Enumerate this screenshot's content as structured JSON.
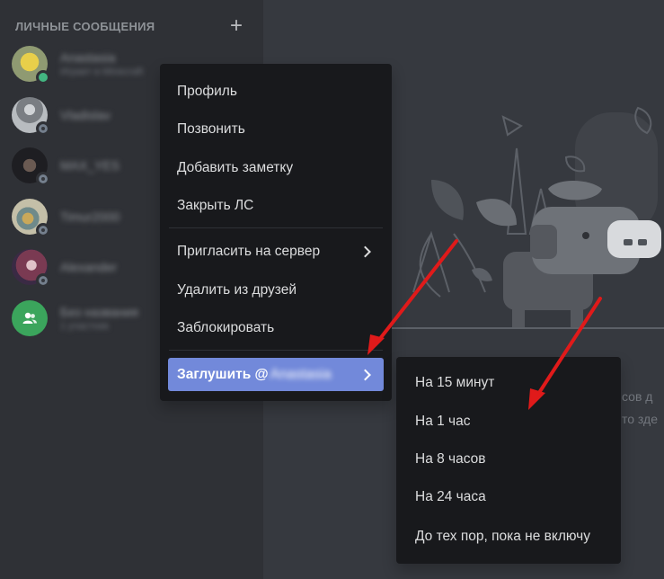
{
  "sidebar": {
    "title": "ЛИЧНЫЕ СООБЩЕНИЯ",
    "add_icon": "plus-icon",
    "dms": [
      {
        "name": "Anastasia",
        "sub": "Играет в Minecraft",
        "status": "online",
        "avatar_color": "#c9b04a"
      },
      {
        "name": "Vladislav",
        "sub": "",
        "status": "offline",
        "avatar_color": "#6a6e73"
      },
      {
        "name": "MAX_YES",
        "sub": "",
        "status": "offline",
        "avatar_color": "#2a2a2e"
      },
      {
        "name": "Timur2000",
        "sub": "",
        "status": "offline",
        "avatar_color": "#8f8a6a"
      },
      {
        "name": "Alexander",
        "sub": "",
        "status": "offline",
        "avatar_color": "#6b3a4a"
      },
      {
        "name": "Без названия",
        "sub": "1 участник",
        "status": "",
        "avatar_color": "#3ba55c"
      }
    ]
  },
  "context_menu": {
    "profile": "Профиль",
    "call": "Позвонить",
    "add_note": "Добавить заметку",
    "close_dm": "Закрыть ЛС",
    "invite": "Пригласить на сервер",
    "remove_friend": "Удалить из друзей",
    "block": "Заблокировать",
    "mute_prefix": "Заглушить @",
    "mute_name": "Anastasia"
  },
  "mute_submenu": {
    "items": [
      "На 15 минут",
      "На 1 час",
      "На 8 часов",
      "На 24 часа",
      "До тех пор, пока не включу"
    ]
  },
  "background_text": {
    "line1": "сов д",
    "line2": "то зде"
  },
  "colors": {
    "accent": "#7289da",
    "online": "#43b581",
    "arrow": "#e01a1a"
  }
}
